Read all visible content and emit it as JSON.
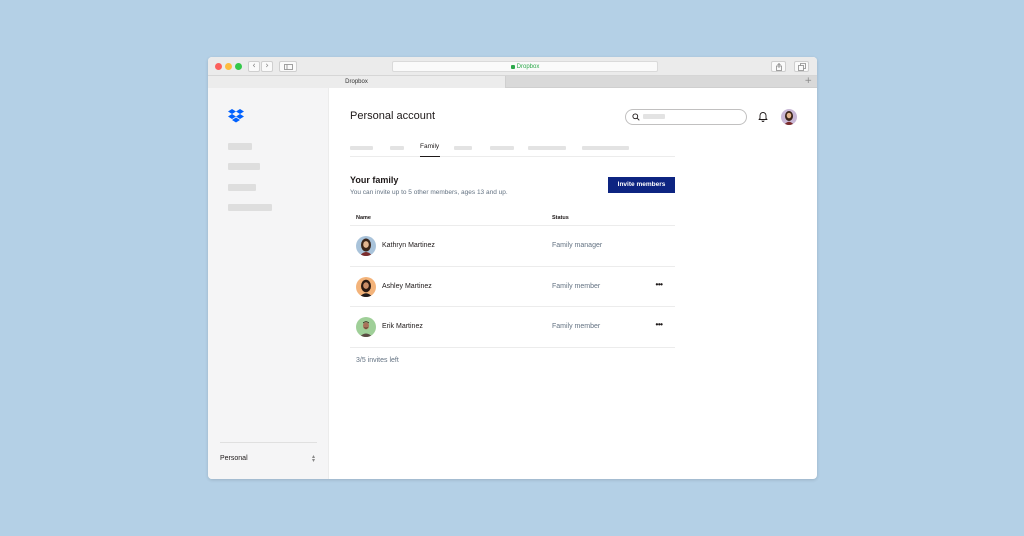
{
  "browser": {
    "url": "Dropbox",
    "tab_title": "Dropbox",
    "new_tab": "+",
    "back": "‹",
    "forward": "›"
  },
  "sidebar": {
    "account_label": "Personal",
    "switch_icon": "chevron-updown-icon"
  },
  "header": {
    "title": "Personal account",
    "search_placeholder": ""
  },
  "tabs": {
    "active_label": "Family"
  },
  "family": {
    "title": "Your family",
    "subtitle": "You can invite up to 5 other members, ages 13 and up.",
    "invite_button": "Invite members",
    "columns": {
      "name": "Name",
      "status": "Status"
    },
    "members": [
      {
        "name": "Kathryn Martinez",
        "status": "Family manager",
        "more": ""
      },
      {
        "name": "Ashley Martinez",
        "status": "Family member",
        "more": "•••"
      },
      {
        "name": "Erik Martinez",
        "status": "Family member",
        "more": "•••"
      }
    ],
    "invites_left": "3/5 invites left"
  },
  "colors": {
    "background": "#b4d0e6",
    "primary_button": "#0d2481",
    "dropbox_blue": "#0061fe",
    "sidebar_bg": "#f5f5f6"
  }
}
